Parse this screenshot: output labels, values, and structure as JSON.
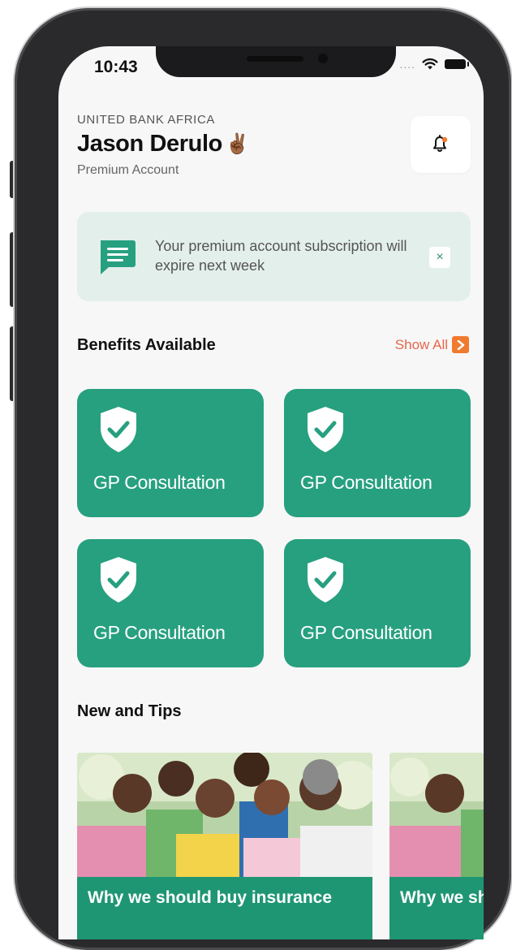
{
  "status_bar": {
    "time": "10:43",
    "signal_dots": "...."
  },
  "header": {
    "bank_name": "UNITED BANK AFRICA",
    "user_name": "Jason Derulo",
    "user_emoji": "✌🏾",
    "account_type": "Premium Account"
  },
  "banner": {
    "message": "Your premium account subscription will expire next week",
    "close_label": "×"
  },
  "benefits": {
    "title": "Benefits Available",
    "show_all_label": "Show All",
    "items": [
      {
        "label": "GP Consultation"
      },
      {
        "label": "GP Consultation"
      },
      {
        "label": "GP Consultation"
      },
      {
        "label": "GP Consultation"
      }
    ]
  },
  "news": {
    "title": "New and Tips",
    "items": [
      {
        "caption": "Why we should buy insurance"
      },
      {
        "caption": "Why we should buy insurance"
      }
    ]
  },
  "colors": {
    "accent_green": "#27a07f",
    "banner_bg": "#e3efeb",
    "show_all": "#e8664a",
    "show_all_icon": "#f07a2e",
    "bell_dot": "#f07a2e"
  },
  "icons": {
    "notification": "bell-icon",
    "message": "chat-message-icon",
    "benefit": "shield-check-icon",
    "close": "close-icon",
    "show_all": "chevron-right-icon"
  }
}
